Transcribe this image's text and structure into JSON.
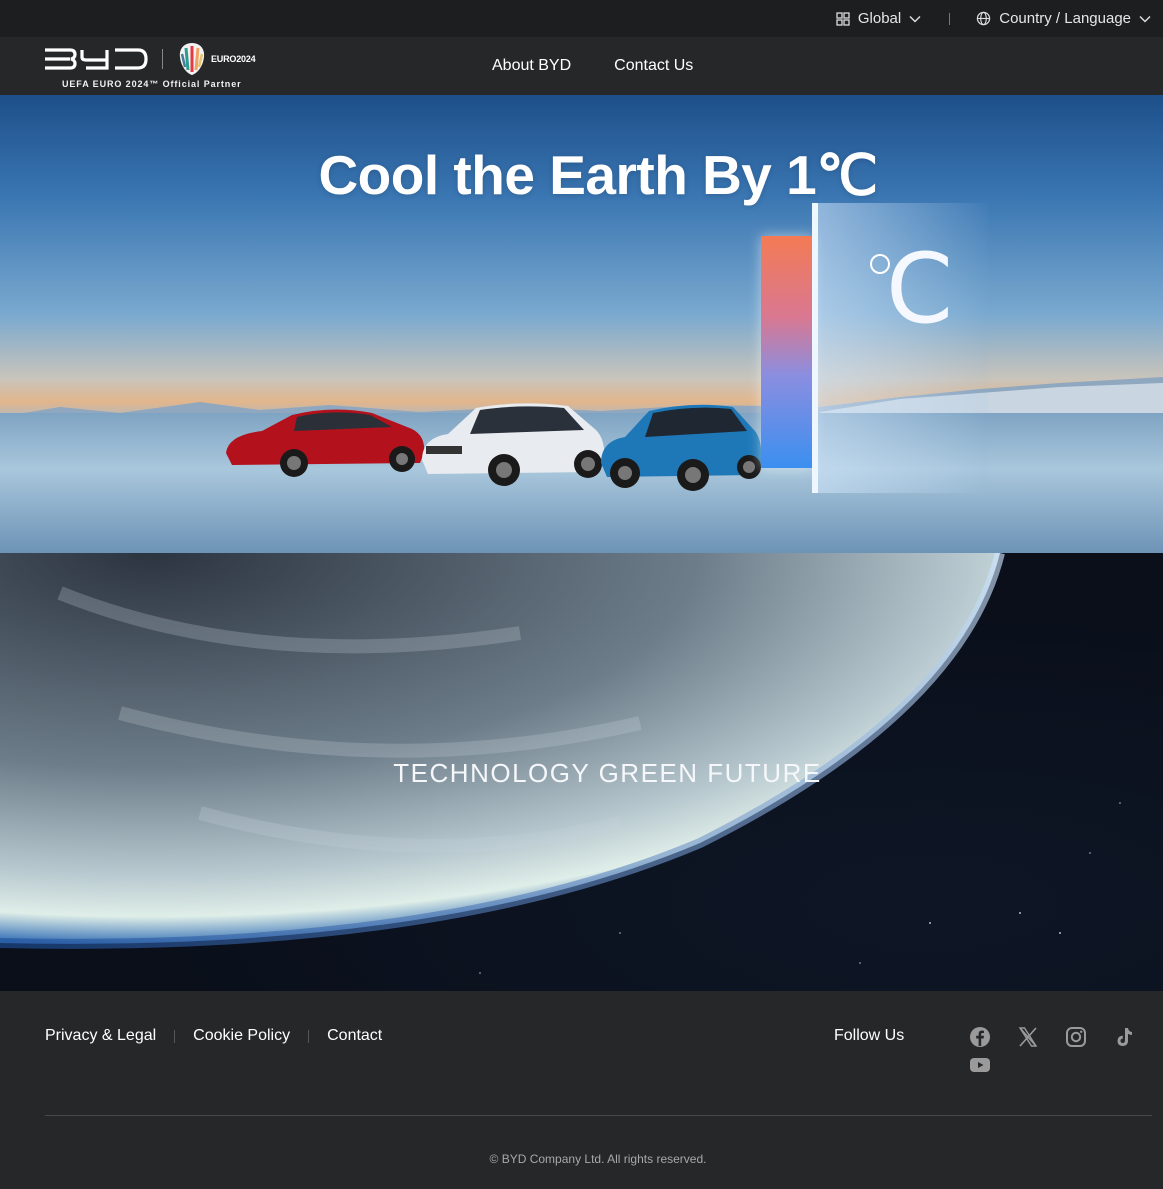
{
  "topbar": {
    "region_label": "Global",
    "language_label": "Country / Language"
  },
  "header": {
    "brand": "BYD",
    "euro_logo_text": "EURO2024",
    "partner_text": "UEFA EURO 2024™ Official Partner",
    "nav": [
      {
        "label": "About BYD"
      },
      {
        "label": "Contact Us"
      }
    ]
  },
  "hero": {
    "title": "Cool the Earth By 1℃",
    "door_symbol": "C"
  },
  "earth": {
    "slogan": "TECHNOLOGY GREEN FUTURE"
  },
  "footer": {
    "links": [
      {
        "label": "Privacy & Legal"
      },
      {
        "label": "Cookie Policy"
      },
      {
        "label": "Contact"
      }
    ],
    "follow_label": "Follow Us",
    "social": [
      "facebook-icon",
      "x-icon",
      "instagram-icon",
      "tiktok-icon",
      "youtube-icon"
    ],
    "copyright": "© BYD Company Ltd. All rights reserved."
  }
}
